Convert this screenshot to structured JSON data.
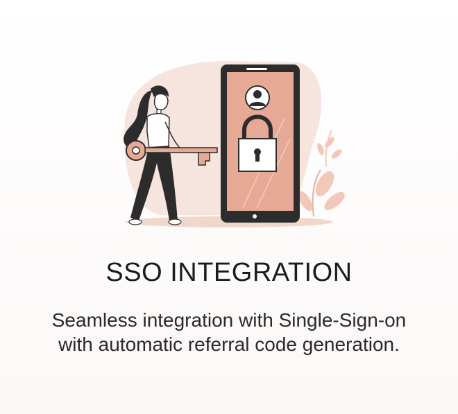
{
  "card": {
    "title": "SSO INTEGRATION",
    "description": "Seamless integration with Single-Sign-on with automatic referral code generation."
  },
  "colors": {
    "accent": "#e6a996",
    "blob": "#f6e4de",
    "dark": "#2c2c2c",
    "white": "#ffffff"
  },
  "icons": [
    "user-avatar-icon",
    "padlock-icon",
    "key-icon",
    "plant-leaves-icon"
  ]
}
